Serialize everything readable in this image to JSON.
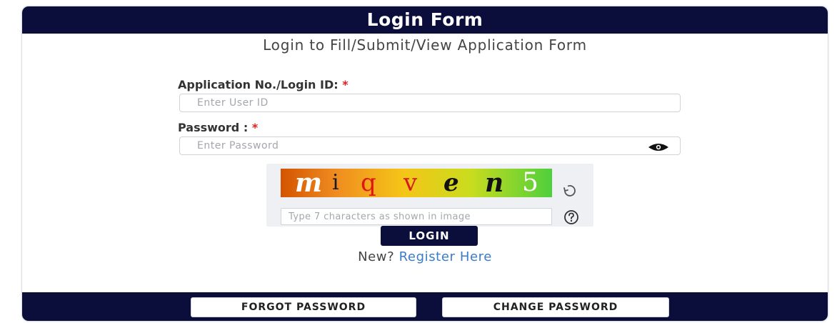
{
  "header": {
    "title": "Login Form"
  },
  "subtitle": "Login to Fill/Submit/View Application Form",
  "form": {
    "login_id_label": "Application No./Login ID:",
    "login_id_placeholder": "Enter User ID",
    "password_label": "Password :",
    "password_placeholder": "Enter Password",
    "required_mark": "*"
  },
  "captcha": {
    "characters": [
      "m",
      "i",
      "q",
      "v",
      "e",
      "n",
      "5"
    ],
    "input_placeholder": "Type 7 characters as shown in image",
    "refresh_icon": "refresh-icon",
    "help_icon": "help-icon"
  },
  "actions": {
    "login_label": "LOGIN",
    "new_prefix": "New?",
    "register_label": "Register Here"
  },
  "footer": {
    "forgot_password_label": "FORGOT PASSWORD",
    "change_password_label": "CHANGE PASSWORD"
  },
  "colors": {
    "primary_navy": "#0b0d3a",
    "link_blue": "#3a7cc8",
    "required_red": "#e02020"
  }
}
